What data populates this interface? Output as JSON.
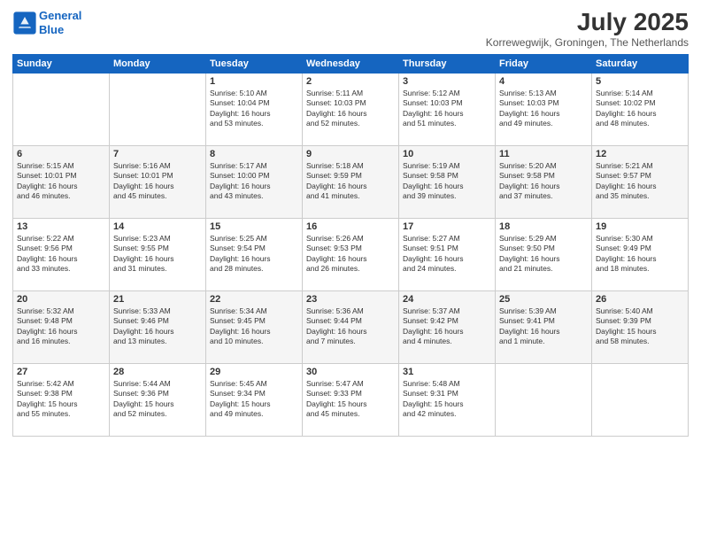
{
  "logo": {
    "line1": "General",
    "line2": "Blue"
  },
  "title": "July 2025",
  "subtitle": "Korrewegwijk, Groningen, The Netherlands",
  "weekdays": [
    "Sunday",
    "Monday",
    "Tuesday",
    "Wednesday",
    "Thursday",
    "Friday",
    "Saturday"
  ],
  "weeks": [
    [
      {
        "day": "",
        "info": ""
      },
      {
        "day": "",
        "info": ""
      },
      {
        "day": "1",
        "info": "Sunrise: 5:10 AM\nSunset: 10:04 PM\nDaylight: 16 hours\nand 53 minutes."
      },
      {
        "day": "2",
        "info": "Sunrise: 5:11 AM\nSunset: 10:03 PM\nDaylight: 16 hours\nand 52 minutes."
      },
      {
        "day": "3",
        "info": "Sunrise: 5:12 AM\nSunset: 10:03 PM\nDaylight: 16 hours\nand 51 minutes."
      },
      {
        "day": "4",
        "info": "Sunrise: 5:13 AM\nSunset: 10:03 PM\nDaylight: 16 hours\nand 49 minutes."
      },
      {
        "day": "5",
        "info": "Sunrise: 5:14 AM\nSunset: 10:02 PM\nDaylight: 16 hours\nand 48 minutes."
      }
    ],
    [
      {
        "day": "6",
        "info": "Sunrise: 5:15 AM\nSunset: 10:01 PM\nDaylight: 16 hours\nand 46 minutes."
      },
      {
        "day": "7",
        "info": "Sunrise: 5:16 AM\nSunset: 10:01 PM\nDaylight: 16 hours\nand 45 minutes."
      },
      {
        "day": "8",
        "info": "Sunrise: 5:17 AM\nSunset: 10:00 PM\nDaylight: 16 hours\nand 43 minutes."
      },
      {
        "day": "9",
        "info": "Sunrise: 5:18 AM\nSunset: 9:59 PM\nDaylight: 16 hours\nand 41 minutes."
      },
      {
        "day": "10",
        "info": "Sunrise: 5:19 AM\nSunset: 9:58 PM\nDaylight: 16 hours\nand 39 minutes."
      },
      {
        "day": "11",
        "info": "Sunrise: 5:20 AM\nSunset: 9:58 PM\nDaylight: 16 hours\nand 37 minutes."
      },
      {
        "day": "12",
        "info": "Sunrise: 5:21 AM\nSunset: 9:57 PM\nDaylight: 16 hours\nand 35 minutes."
      }
    ],
    [
      {
        "day": "13",
        "info": "Sunrise: 5:22 AM\nSunset: 9:56 PM\nDaylight: 16 hours\nand 33 minutes."
      },
      {
        "day": "14",
        "info": "Sunrise: 5:23 AM\nSunset: 9:55 PM\nDaylight: 16 hours\nand 31 minutes."
      },
      {
        "day": "15",
        "info": "Sunrise: 5:25 AM\nSunset: 9:54 PM\nDaylight: 16 hours\nand 28 minutes."
      },
      {
        "day": "16",
        "info": "Sunrise: 5:26 AM\nSunset: 9:53 PM\nDaylight: 16 hours\nand 26 minutes."
      },
      {
        "day": "17",
        "info": "Sunrise: 5:27 AM\nSunset: 9:51 PM\nDaylight: 16 hours\nand 24 minutes."
      },
      {
        "day": "18",
        "info": "Sunrise: 5:29 AM\nSunset: 9:50 PM\nDaylight: 16 hours\nand 21 minutes."
      },
      {
        "day": "19",
        "info": "Sunrise: 5:30 AM\nSunset: 9:49 PM\nDaylight: 16 hours\nand 18 minutes."
      }
    ],
    [
      {
        "day": "20",
        "info": "Sunrise: 5:32 AM\nSunset: 9:48 PM\nDaylight: 16 hours\nand 16 minutes."
      },
      {
        "day": "21",
        "info": "Sunrise: 5:33 AM\nSunset: 9:46 PM\nDaylight: 16 hours\nand 13 minutes."
      },
      {
        "day": "22",
        "info": "Sunrise: 5:34 AM\nSunset: 9:45 PM\nDaylight: 16 hours\nand 10 minutes."
      },
      {
        "day": "23",
        "info": "Sunrise: 5:36 AM\nSunset: 9:44 PM\nDaylight: 16 hours\nand 7 minutes."
      },
      {
        "day": "24",
        "info": "Sunrise: 5:37 AM\nSunset: 9:42 PM\nDaylight: 16 hours\nand 4 minutes."
      },
      {
        "day": "25",
        "info": "Sunrise: 5:39 AM\nSunset: 9:41 PM\nDaylight: 16 hours\nand 1 minute."
      },
      {
        "day": "26",
        "info": "Sunrise: 5:40 AM\nSunset: 9:39 PM\nDaylight: 15 hours\nand 58 minutes."
      }
    ],
    [
      {
        "day": "27",
        "info": "Sunrise: 5:42 AM\nSunset: 9:38 PM\nDaylight: 15 hours\nand 55 minutes."
      },
      {
        "day": "28",
        "info": "Sunrise: 5:44 AM\nSunset: 9:36 PM\nDaylight: 15 hours\nand 52 minutes."
      },
      {
        "day": "29",
        "info": "Sunrise: 5:45 AM\nSunset: 9:34 PM\nDaylight: 15 hours\nand 49 minutes."
      },
      {
        "day": "30",
        "info": "Sunrise: 5:47 AM\nSunset: 9:33 PM\nDaylight: 15 hours\nand 45 minutes."
      },
      {
        "day": "31",
        "info": "Sunrise: 5:48 AM\nSunset: 9:31 PM\nDaylight: 15 hours\nand 42 minutes."
      },
      {
        "day": "",
        "info": ""
      },
      {
        "day": "",
        "info": ""
      }
    ]
  ]
}
